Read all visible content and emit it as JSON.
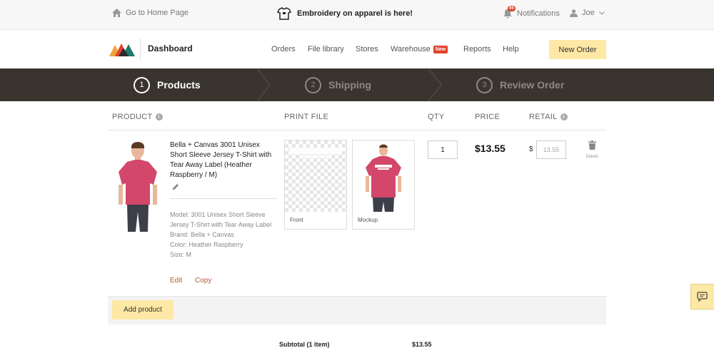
{
  "topbar": {
    "home_label": "Go to Home Page",
    "promo_text": "Embroidery on apparel is here!",
    "notifications_label": "Notifications",
    "notifications_count": "98",
    "user_name": "Joe"
  },
  "nav": {
    "title": "Dashboard",
    "items": [
      {
        "label": "Orders"
      },
      {
        "label": "File library"
      },
      {
        "label": "Stores"
      },
      {
        "label": "Warehouse",
        "badge": "New"
      },
      {
        "label": "Reports"
      },
      {
        "label": "Help"
      }
    ],
    "cta": "New Order"
  },
  "steps": [
    {
      "num": "1",
      "label": "Products",
      "active": true
    },
    {
      "num": "2",
      "label": "Shipping",
      "active": false
    },
    {
      "num": "3",
      "label": "Review Order",
      "active": false
    }
  ],
  "table": {
    "headers": {
      "product": "PRODUCT",
      "print_file": "PRINT FILE",
      "qty": "QTY",
      "price": "PRICE",
      "retail": "RETAIL"
    }
  },
  "item": {
    "title": "Bella + Canvas 3001 Unisex Short Sleeve Jersey T-Shirt with Tear Away Label (Heather Raspberry / M)",
    "details": {
      "model": "Model: 3001 Unisex Short Sleeve Jersey T-Shirt with Tear Away Label",
      "brand": "Brand: Bella + Canvas",
      "color": "Color: Heather Raspberry",
      "size": "Size: M"
    },
    "edit_label": "Edit",
    "copy_label": "Copy",
    "front_label": "Front",
    "mockup_label": "Mockup",
    "qty": "1",
    "price": "$13.55",
    "currency_symbol": "$",
    "retail_placeholder": "13.55",
    "delete_label": "Delete",
    "shirt_color": "#d2476a"
  },
  "footer": {
    "add_product": "Add product",
    "subtotal_label": "Subtotal (1 item)",
    "subtotal_value": "$13.55"
  },
  "colors": {
    "accent_yellow": "#fde8a5",
    "stepper_bg": "#3a342f",
    "badge_red": "#e2412b",
    "link": "#b05a3a"
  }
}
